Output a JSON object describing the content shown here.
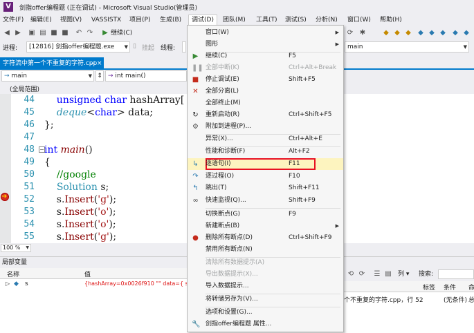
{
  "window": {
    "title": "剑指offer编程题 (正在调试) - Microsoft Visual Studio(管理员)",
    "logo": "V"
  },
  "menubar": {
    "items": [
      "文件(F)",
      "编辑(E)",
      "视图(V)",
      "VASSISTX",
      "项目(P)",
      "生成(B)",
      "调试(D)",
      "团队(M)",
      "工具(T)",
      "测试(S)",
      "分析(N)",
      "窗口(W)",
      "帮助(H)"
    ],
    "open_item": "调试(D)"
  },
  "toolbar1": {
    "continue_label": "继续(C)"
  },
  "toolbar2": {
    "process_label": "进程:",
    "process_value": "[12816] 剑指offer编程题.exe",
    "suspend_label": "挂起",
    "thread_label": "线程:",
    "stack_value": "main"
  },
  "editor_tab": {
    "filename": "字符流中第一个不重复的字符.cpp"
  },
  "navbar": {
    "scope_left": "main",
    "scope_right": "int main()"
  },
  "scopebar": {
    "text": "(全局范围)"
  },
  "code": {
    "lines": [
      {
        "num": "44",
        "text": "    unsigned char hashArray["
      },
      {
        "num": "45",
        "text": "    deque<char> data;"
      },
      {
        "num": "46",
        "text": "};"
      },
      {
        "num": "47",
        "text": ""
      },
      {
        "num": "48",
        "text": "int main()"
      },
      {
        "num": "49",
        "text": "{"
      },
      {
        "num": "50",
        "text": "    //google"
      },
      {
        "num": "51",
        "text": "    Solution s;"
      },
      {
        "num": "52",
        "text": "    s.Insert('g');"
      },
      {
        "num": "53",
        "text": "    s.Insert('o');"
      },
      {
        "num": "54",
        "text": "    s.Insert('o');"
      },
      {
        "num": "55",
        "text": "    s.Insert('g');"
      }
    ]
  },
  "zoom": {
    "value": "100 %"
  },
  "locals": {
    "title": "局部变量",
    "col_name": "名称",
    "col_value": "值",
    "row": {
      "name": "s",
      "value": "{hashArray=0x0026f910 \"\" data={ size="
    }
  },
  "callstack": {
    "search_label": "搜索:",
    "col_tag": "标签",
    "col_condition": "条件",
    "col_more": "命",
    "list_label": "列 ▾",
    "row_text": "个不重复的字符.cpp，行 52",
    "row_condition": "(无条件)",
    "row_more": "总"
  },
  "debug_menu": {
    "items": [
      {
        "label": "窗口(W)",
        "shortcut": "",
        "submenu": true,
        "disabled": false,
        "icon": ""
      },
      {
        "label": "图形",
        "shortcut": "",
        "submenu": true,
        "disabled": false,
        "icon": ""
      },
      {
        "label": "继续(C)",
        "shortcut": "F5",
        "submenu": false,
        "disabled": false,
        "icon": "play-icon"
      },
      {
        "label": "全部中断(K)",
        "shortcut": "Ctrl+Alt+Break",
        "submenu": false,
        "disabled": true,
        "icon": "pause-icon"
      },
      {
        "label": "停止调试(E)",
        "shortcut": "Shift+F5",
        "submenu": false,
        "disabled": false,
        "icon": "stop-icon"
      },
      {
        "label": "全部分离(L)",
        "shortcut": "",
        "submenu": false,
        "disabled": false,
        "icon": "detach-icon"
      },
      {
        "label": "全部终止(M)",
        "shortcut": "",
        "submenu": false,
        "disabled": false,
        "icon": ""
      },
      {
        "label": "重新启动(R)",
        "shortcut": "Ctrl+Shift+F5",
        "submenu": false,
        "disabled": false,
        "icon": "restart-icon"
      },
      {
        "label": "附加到进程(P)...",
        "shortcut": "",
        "submenu": false,
        "disabled": false,
        "icon": "attach-icon"
      },
      {
        "label": "异常(X)...",
        "shortcut": "Ctrl+Alt+E",
        "submenu": false,
        "disabled": false,
        "icon": ""
      },
      {
        "label": "性能和诊断(F)",
        "shortcut": "Alt+F2",
        "submenu": false,
        "disabled": false,
        "icon": ""
      },
      {
        "label": "逐语句(I)",
        "shortcut": "F11",
        "submenu": false,
        "disabled": false,
        "icon": "step-into-icon"
      },
      {
        "label": "逐过程(O)",
        "shortcut": "F10",
        "submenu": false,
        "disabled": false,
        "icon": "step-over-icon"
      },
      {
        "label": "跳出(T)",
        "shortcut": "Shift+F11",
        "submenu": false,
        "disabled": false,
        "icon": "step-out-icon"
      },
      {
        "label": "快速监视(Q)...",
        "shortcut": "Shift+F9",
        "submenu": false,
        "disabled": false,
        "icon": "quickwatch-icon"
      },
      {
        "label": "切换断点(G)",
        "shortcut": "F9",
        "submenu": false,
        "disabled": false,
        "icon": ""
      },
      {
        "label": "新建断点(B)",
        "shortcut": "",
        "submenu": true,
        "disabled": false,
        "icon": ""
      },
      {
        "label": "删除所有断点(D)",
        "shortcut": "Ctrl+Shift+F9",
        "submenu": false,
        "disabled": false,
        "icon": "delete-breakpoints-icon"
      },
      {
        "label": "禁用所有断点(N)",
        "shortcut": "",
        "submenu": false,
        "disabled": false,
        "icon": ""
      },
      {
        "label": "清除所有数据提示(A)",
        "shortcut": "",
        "submenu": false,
        "disabled": true,
        "icon": ""
      },
      {
        "label": "导出数据提示(X)...",
        "shortcut": "",
        "submenu": false,
        "disabled": true,
        "icon": ""
      },
      {
        "label": "导入数据提示...",
        "shortcut": "",
        "submenu": false,
        "disabled": false,
        "icon": ""
      },
      {
        "label": "将转储另存为(V)...",
        "shortcut": "",
        "submenu": false,
        "disabled": false,
        "icon": ""
      },
      {
        "label": "选项和设置(G)...",
        "shortcut": "",
        "submenu": false,
        "disabled": false,
        "icon": ""
      },
      {
        "label": "剑指offer编程题 属性...",
        "shortcut": "",
        "submenu": false,
        "disabled": false,
        "icon": "wrench-icon"
      }
    ],
    "highlighted": "逐语句(I)"
  },
  "colors": {
    "accent": "#007acc",
    "highlight_bg": "#fdf4bf",
    "highlight_border": "#e81123",
    "keyword": "#0000ff",
    "type": "#2b91af",
    "comment": "#008000",
    "string": "#a31515"
  }
}
